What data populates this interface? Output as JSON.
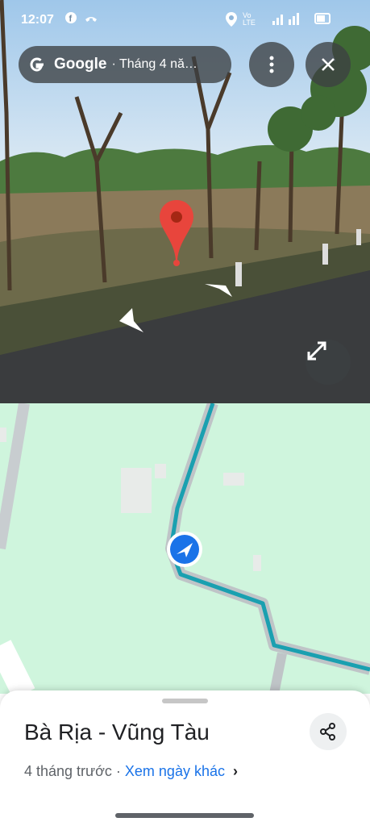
{
  "status_bar": {
    "time": "12:07",
    "facebook_icon": "facebook-icon",
    "call_icon": "call-icon",
    "location_icon": "location-icon",
    "volte": "Vo LTE",
    "signal_icon": "signal-icon",
    "battery_icon": "battery-icon"
  },
  "street_view": {
    "brand": "Google",
    "capture_date": "· Tháng 4 nă…",
    "menu_icon": "more-vert-icon",
    "close_icon": "close-icon",
    "expand_icon": "expand-icon",
    "pin_color": "#e8453c"
  },
  "map": {
    "background": "#cff5dd",
    "route_color": "#1aa0b0",
    "location_arrow_color": "#1a73e8"
  },
  "sheet": {
    "place_name": "Bà Rịa - Vũng Tàu",
    "time_ago": "4 tháng trước",
    "separator": " · ",
    "other_dates_link": "Xem ngày khác",
    "chevron": "›",
    "share_icon": "share-icon"
  }
}
